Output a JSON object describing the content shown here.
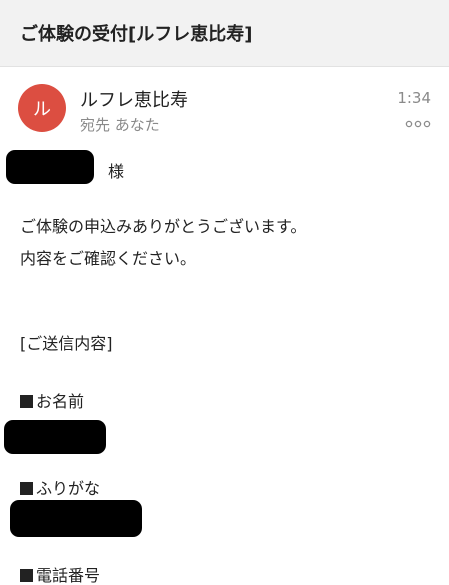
{
  "header": {
    "subject": "ご体験の受付[ルフレ恵比寿]"
  },
  "sender": {
    "avatar_initial": "ル",
    "avatar_color": "#dc4e41",
    "name": "ルフレ恵比寿",
    "recipient_label": "宛先 あなた",
    "time": "1:34",
    "more_icon": "more-dots-icon"
  },
  "body": {
    "salutation_suffix": "様",
    "intro_line1": "ご体験の申込みありがとうございます。",
    "intro_line2": "内容をご確認ください。",
    "section_heading": "[ご送信内容]",
    "field_name_label": "お名前",
    "field_furigana_label": "ふりがな",
    "field_phone_label": "電話番号"
  }
}
